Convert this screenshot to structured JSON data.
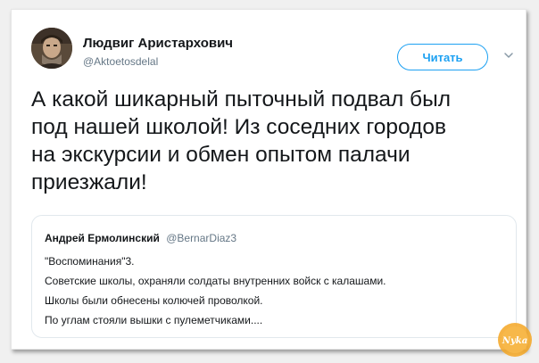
{
  "author": {
    "name": "Людвиг Аристархович",
    "handle": "@Aktoetosdelal"
  },
  "follow_label": "Читать",
  "tweet": {
    "lines": [
      "А какой шикарный пыточный подвал был",
      "под нашей школой! Из соседних городов",
      "на экскурсии и обмен опытом палачи",
      "приезжали!"
    ]
  },
  "quoted": {
    "name": "Андрей Ермолинский",
    "handle": "@BernarDiaz3",
    "lines": [
      "\"Воспоминания\"3.",
      "Советские школы, охраняли солдаты внутренних войск с калашами.",
      "Школы были обнесены колючей проволкой.",
      "По углам стояли вышки с пулеметчиками...."
    ]
  },
  "watermark": "Nyka",
  "colors": {
    "accent": "#1da1f2",
    "text": "#14171a",
    "muted": "#657786",
    "watermark": "#f5a623"
  },
  "icons": {
    "caret": "chevron-down-icon"
  }
}
